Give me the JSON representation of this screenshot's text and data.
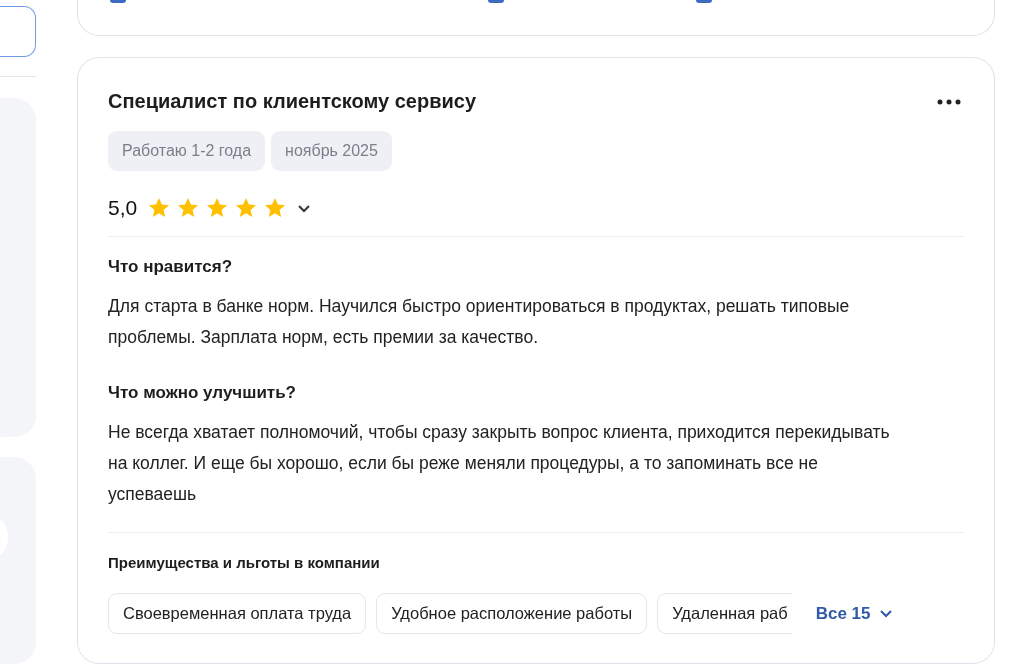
{
  "review": {
    "title": "Специалист по клиентскому сервису",
    "tags": [
      "Работаю 1-2 года",
      "ноябрь 2025"
    ],
    "rating": {
      "value": "5,0",
      "stars": 5
    },
    "sections": [
      {
        "heading": "Что нравится?",
        "text": "Для старта в банке норм. Научился быстро ориентироваться в продуктах, решать типовые проблемы. Зарплата норм, есть премии за качество."
      },
      {
        "heading": "Что можно улучшить?",
        "text": "Не всегда хватает полномочий, чтобы сразу закрыть вопрос клиента, приходится перекидывать на коллег. И еще бы хорошо, если бы реже меняли процедуры, а то запоминать все не успеваешь"
      }
    ],
    "benefits": {
      "heading": "Преимущества и льготы в компании",
      "chips": [
        "Своевременная оплата труда",
        "Удобное расположение работы",
        "Удаленная раб"
      ],
      "more": "Все 15"
    }
  }
}
